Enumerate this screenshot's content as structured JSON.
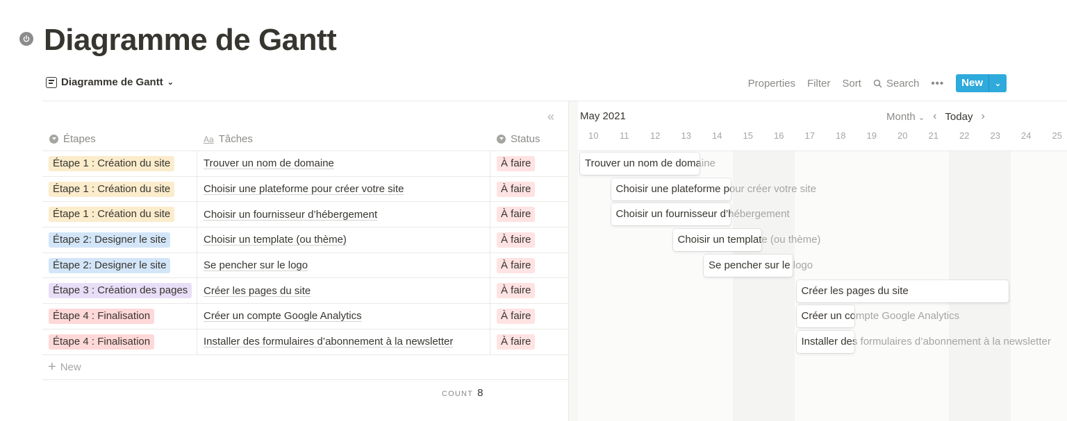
{
  "page": {
    "icon": "power-icon",
    "title": "Diagramme de Gantt"
  },
  "view": {
    "icon": "timeline-view-icon",
    "name": "Diagramme de Gantt"
  },
  "toolbar": {
    "properties": "Properties",
    "filter": "Filter",
    "sort": "Sort",
    "search": "Search",
    "more": "•••",
    "new": "New"
  },
  "table": {
    "collapse_icon": "«",
    "columns": [
      {
        "icon": "select-icon",
        "label": "Étapes"
      },
      {
        "icon": "title-icon",
        "label": "Tâches",
        "icon_text": "Aa"
      },
      {
        "icon": "select-icon",
        "label": "Status"
      }
    ],
    "rows": [
      {
        "etape": "Étape 1 : Création du site",
        "etape_color": "#fbeccc",
        "tache": "Trouver un nom de domaine",
        "status": "À faire",
        "status_color": "#ffe2e2"
      },
      {
        "etape": "Étape 1 : Création du site",
        "etape_color": "#fbeccc",
        "tache": "Choisir une plateforme pour créer votre site",
        "status": "À faire",
        "status_color": "#ffe2e2"
      },
      {
        "etape": "Étape 1 : Création du site",
        "etape_color": "#fbeccc",
        "tache": "Choisir un fournisseur d’hébergement",
        "status": "À faire",
        "status_color": "#ffe2e2"
      },
      {
        "etape": "Étape 2: Designer le site",
        "etape_color": "#d3e5f8",
        "tache": "Choisir un template (ou thème)",
        "status": "À faire",
        "status_color": "#ffe2e2"
      },
      {
        "etape": "Étape 2: Designer le site",
        "etape_color": "#d3e5f8",
        "tache": "Se pencher sur le logo",
        "status": "À faire",
        "status_color": "#ffe2e2"
      },
      {
        "etape": "Étape 3 : Création des pages",
        "etape_color": "#e8def8",
        "tache": "Créer les pages du site",
        "status": "À faire",
        "status_color": "#ffe2e2"
      },
      {
        "etape": "Étape 4 : Finalisation",
        "etape_color": "#ffd8d8",
        "tache": "Créer un compte Google Analytics",
        "status": "À faire",
        "status_color": "#ffe2e2"
      },
      {
        "etape": "Étape 4 : Finalisation",
        "etape_color": "#ffd8d8",
        "tache": "Installer des formulaires d’abonnement à la newsletter",
        "status": "À faire",
        "status_color": "#ffe2e2"
      }
    ],
    "add_row": "New",
    "count_label": "COUNT",
    "count_value": "8"
  },
  "timeline": {
    "month": "May 2021",
    "scale": "Month",
    "today": "Today",
    "first_day": 10,
    "days": [
      10,
      11,
      12,
      13,
      14,
      15,
      16,
      17,
      18,
      19,
      20,
      21,
      22,
      23,
      24,
      25
    ],
    "weekend_days": [
      15,
      16,
      22,
      23
    ],
    "bars": [
      {
        "label": "Trouver un nom de domaine",
        "start": 10,
        "end": 13
      },
      {
        "label": "Choisir une plateforme pour créer votre site",
        "start": 11,
        "end": 14
      },
      {
        "label": "Choisir un fournisseur d’hébergement",
        "start": 11,
        "end": 14
      },
      {
        "label": "Choisir un template (ou thème)",
        "start": 13,
        "end": 15
      },
      {
        "label": "Se pencher sur le logo",
        "start": 14,
        "end": 16
      },
      {
        "label": "Créer les pages du site",
        "start": 17,
        "end": 23
      },
      {
        "label": "Créer un compte Google Analytics",
        "start": 17,
        "end": 18
      },
      {
        "label": "Installer des formulaires d’abonnement à la newsletter",
        "start": 17,
        "end": 18
      }
    ]
  },
  "colors": {
    "accent": "#2eaadc"
  }
}
